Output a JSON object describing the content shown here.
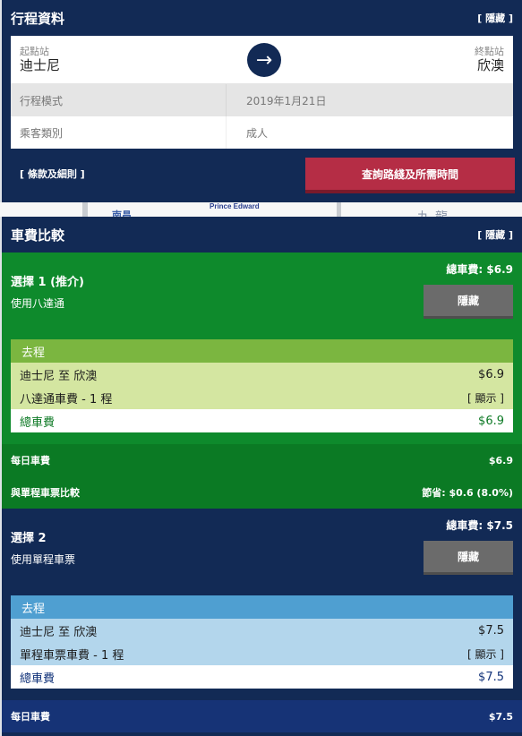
{
  "trip": {
    "title": "行程資料",
    "hide_label": "[ 隱藏 ]",
    "from_label": "起點站",
    "from_name": "迪士尼",
    "to_label": "終點站",
    "to_name": "欣澳",
    "arrow_glyph": "→",
    "mode_label": "行程模式",
    "mode_value": "2019年1月21日",
    "passenger_label": "乘客類別",
    "passenger_value": "成人",
    "terms_label": "[ 條款及細則 ]",
    "search_label": "查詢路綫及所需時間"
  },
  "map": {
    "label_1": "南昌",
    "label_2": "Prince Edward",
    "label_3": "九龍"
  },
  "fare": {
    "title": "車費比較",
    "hide_label": "[ 隱藏 ]",
    "options": [
      {
        "title": "選擇 1 (推介)",
        "subtitle": "使用八達通",
        "total": "總車費: $6.9",
        "hide_button": "隱藏",
        "journey_head": "去程",
        "route": "迪士尼 至 欣澳",
        "route_fare": "$6.9",
        "fare_type": "八達通車費 - 1 程",
        "show_label": "[ 顯示 ]",
        "total_label": "總車費",
        "total_value": "$6.9",
        "daily_label": "每日車費",
        "daily_value": "$6.9",
        "compare_label": "與單程車票比較",
        "compare_value": "節省: $0.6 (8.0%)"
      },
      {
        "title": "選擇 2",
        "subtitle": "使用單程車票",
        "total": "總車費: $7.5",
        "hide_button": "隱藏",
        "journey_head": "去程",
        "route": "迪士尼 至 欣澳",
        "route_fare": "$7.5",
        "fare_type": "單程車票車費 - 1 程",
        "show_label": "[ 顯示 ]",
        "total_label": "總車費",
        "total_value": "$7.5",
        "daily_label": "每日車費",
        "daily_value": "$7.5"
      }
    ]
  },
  "colors": {
    "navy": "#122a55",
    "green": "#0e8a2c",
    "red_button": "#b52d45"
  }
}
